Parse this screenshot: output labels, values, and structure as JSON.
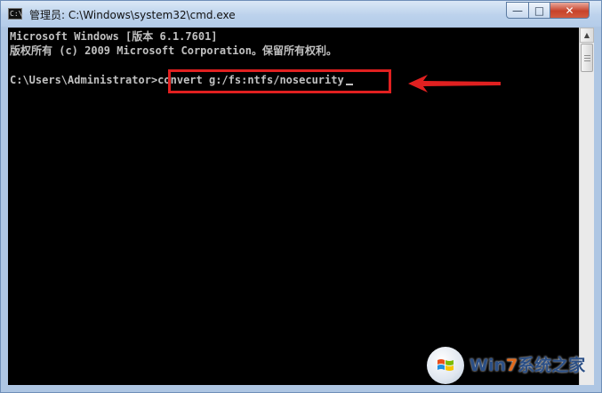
{
  "window": {
    "title": "管理员: C:\\Windows\\system32\\cmd.exe",
    "app_icon_text": "C:\\",
    "controls": {
      "minimize": "—",
      "maximize": "□",
      "close": "✕"
    }
  },
  "console": {
    "lines": [
      "Microsoft Windows [版本 6.1.7601]",
      "版权所有 (c) 2009 Microsoft Corporation。保留所有权利。"
    ],
    "prompt": "C:\\Users\\Administrator>",
    "command": "convert g:/fs:ntfs/nosecurity"
  },
  "annotation": {
    "box_color": "#e02020",
    "arrow_color": "#e02020"
  },
  "scrollbar": {
    "up_arrow": "▲"
  },
  "watermark": {
    "text_prefix": "Win",
    "text_seven": "7",
    "text_suffix": "系统之家"
  },
  "colors": {
    "console_bg": "#000000",
    "console_text": "#c0c0c0",
    "titlebar": "#bcd2ec"
  }
}
